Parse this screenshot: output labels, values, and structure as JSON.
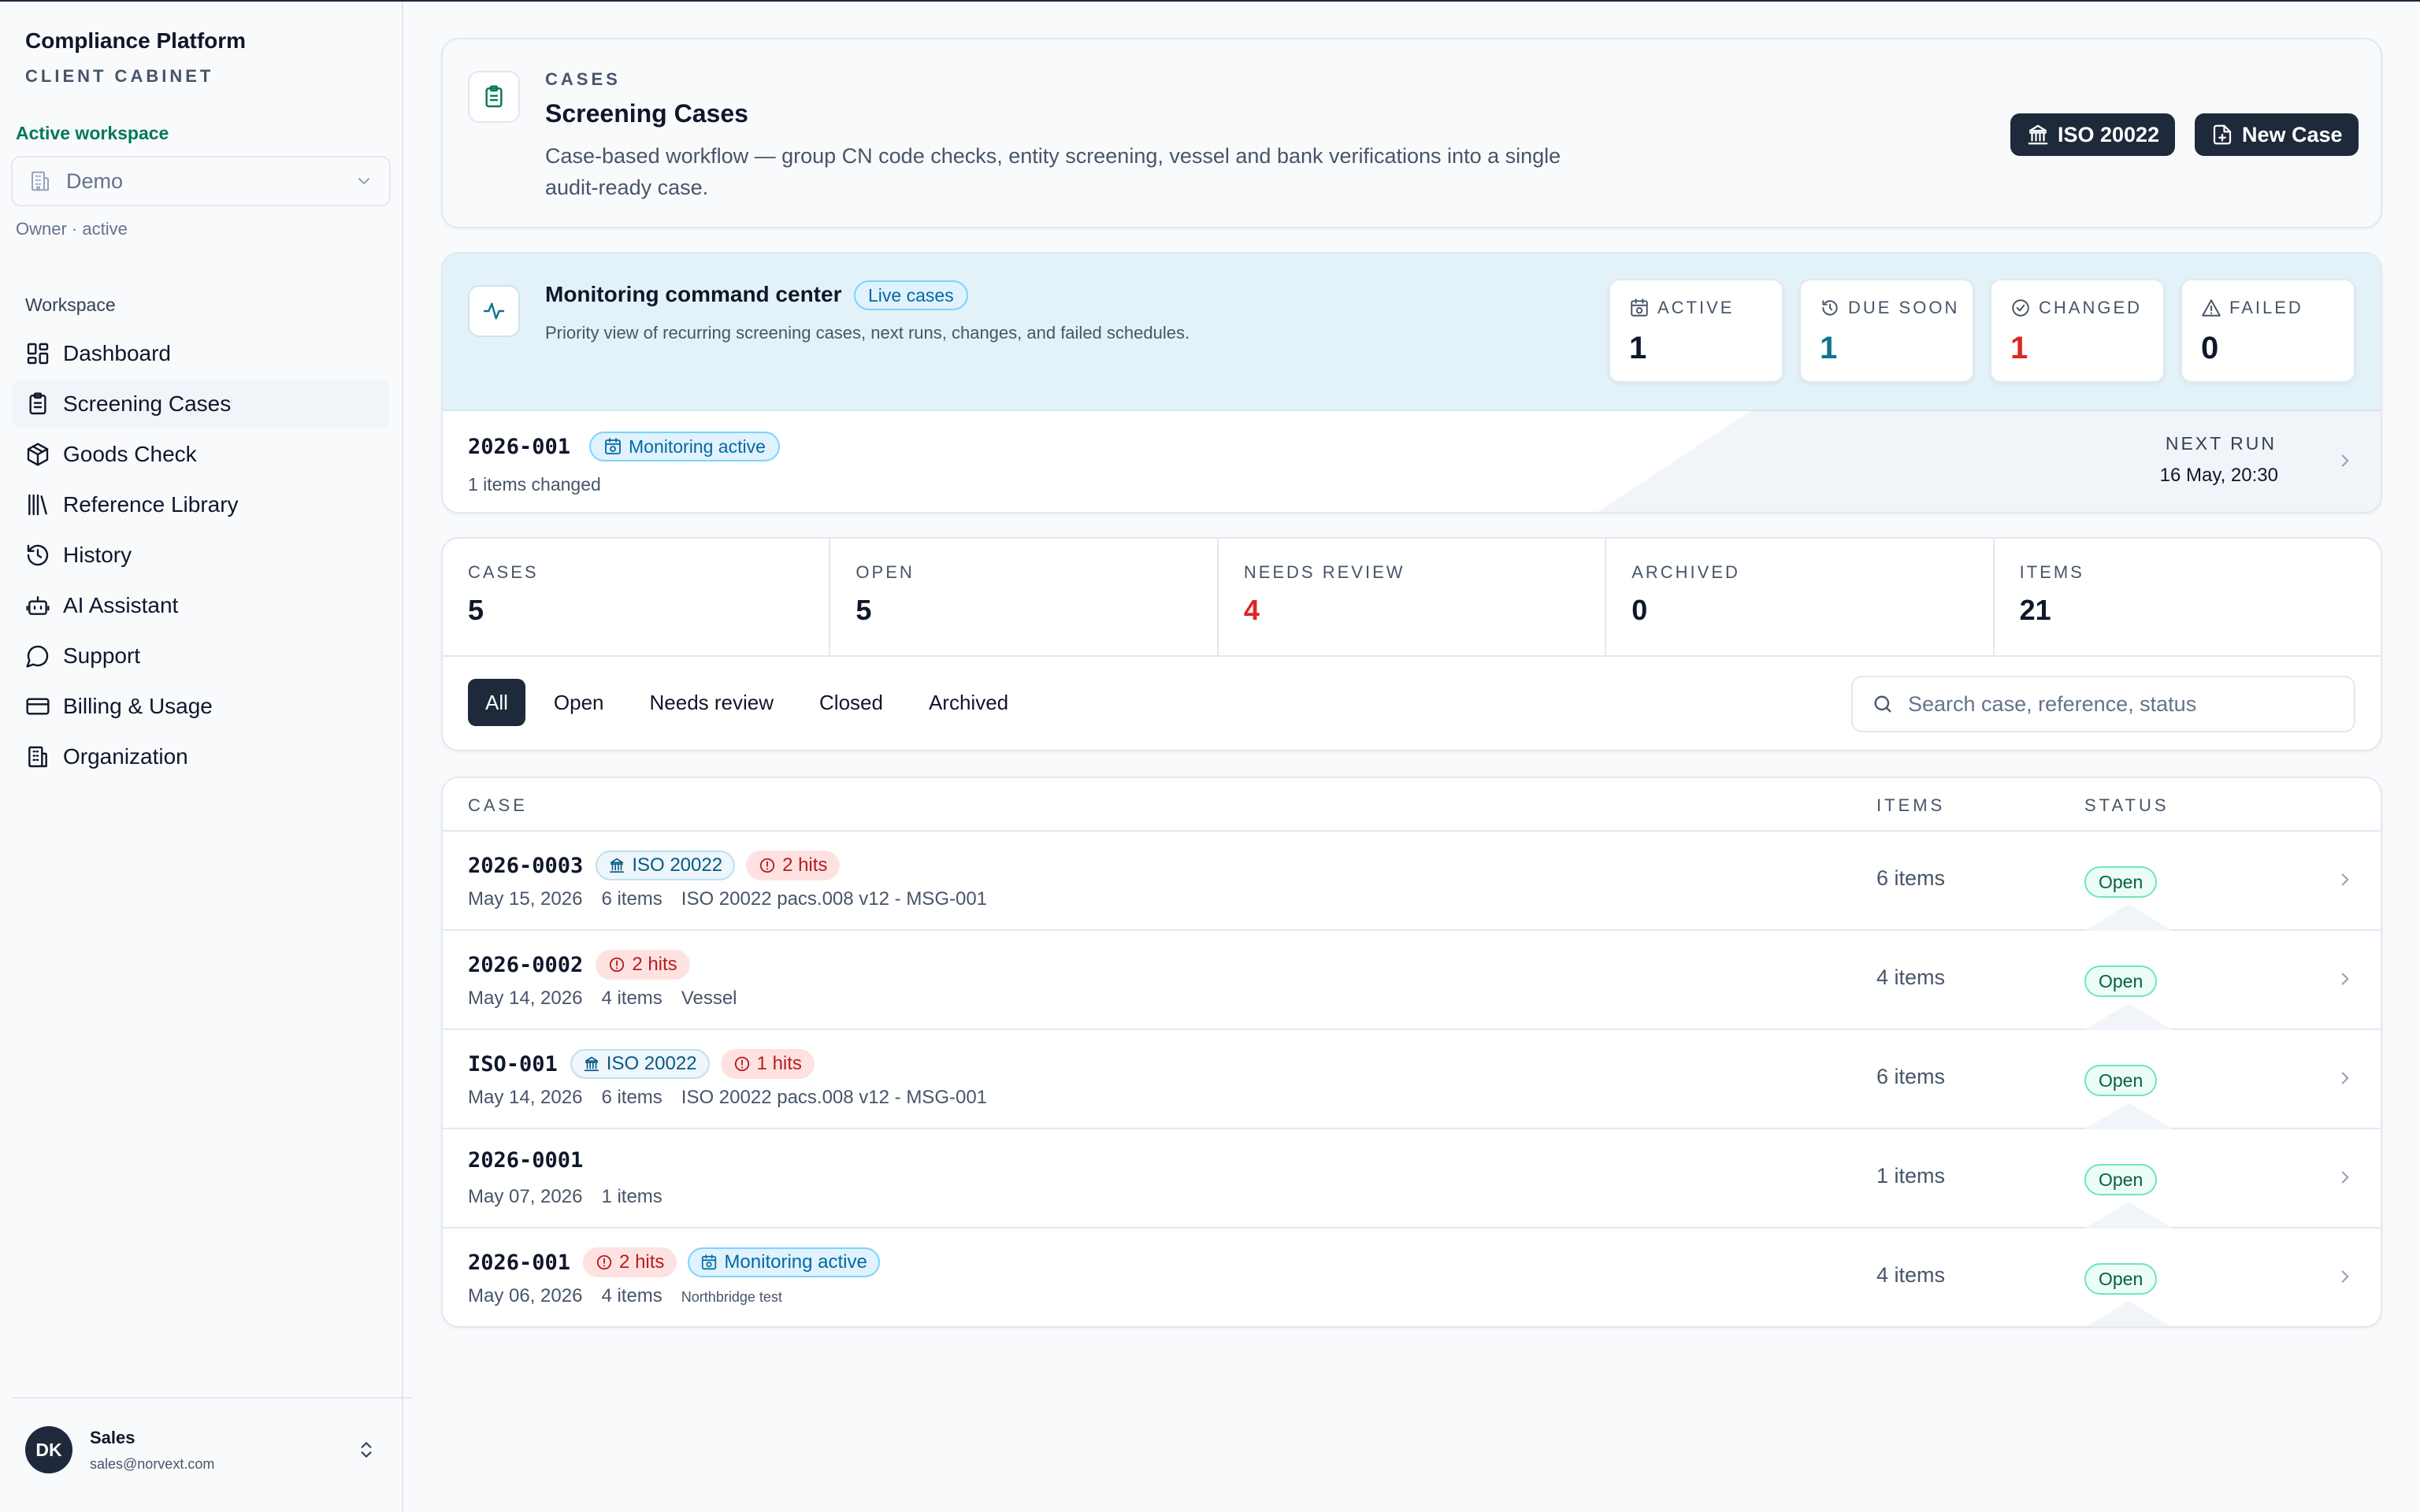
{
  "app": {
    "title": "Compliance Platform",
    "subtitle": "CLIENT CABINET"
  },
  "workspace": {
    "label": "Active workspace",
    "selected": "Demo",
    "role": "Owner · active"
  },
  "nav": {
    "heading": "Workspace",
    "items": [
      {
        "label": "Dashboard",
        "icon": "dashboard-icon",
        "active": false
      },
      {
        "label": "Screening Cases",
        "icon": "clipboard-icon",
        "active": true
      },
      {
        "label": "Goods Check",
        "icon": "package-icon",
        "active": false
      },
      {
        "label": "Reference Library",
        "icon": "library-icon",
        "active": false
      },
      {
        "label": "History",
        "icon": "history-icon",
        "active": false
      },
      {
        "label": "AI Assistant",
        "icon": "bot-icon",
        "active": false
      },
      {
        "label": "Support",
        "icon": "chat-bubble-icon",
        "active": false
      },
      {
        "label": "Billing & Usage",
        "icon": "credit-card-icon",
        "active": false
      },
      {
        "label": "Organization",
        "icon": "building-icon",
        "active": false
      }
    ]
  },
  "user": {
    "initials": "DK",
    "name": "Sales",
    "email": "sales@norvext.com"
  },
  "header": {
    "eyebrow": "CASES",
    "title": "Screening Cases",
    "description": "Case-based workflow — group CN code checks, entity screening, vessel and bank verifications into a single audit-ready case.",
    "iso_button": "ISO 20022",
    "new_case_button": "New Case"
  },
  "monitoring": {
    "title": "Monitoring command center",
    "pill": "Live cases",
    "description": "Priority view of recurring screening cases, next runs, changes, and failed schedules.",
    "stats": [
      {
        "label": "ACTIVE",
        "value": "1",
        "icon": "calendar-clock-icon",
        "color": "#0f172a"
      },
      {
        "label": "DUE SOON",
        "value": "1",
        "icon": "timer-icon",
        "color": "#0e7490"
      },
      {
        "label": "CHANGED",
        "value": "1",
        "icon": "check-circle-icon",
        "color": "#dc2626"
      },
      {
        "label": "FAILED",
        "value": "0",
        "icon": "alert-triangle-icon",
        "color": "#0f172a"
      }
    ],
    "row": {
      "case_id": "2026-001",
      "status": "Monitoring active",
      "changed": "1 items changed",
      "next_run_label": "NEXT RUN",
      "next_run_value": "16 May, 20:30"
    }
  },
  "summary": {
    "stats": [
      {
        "label": "CASES",
        "value": "5",
        "color": "#0f172a"
      },
      {
        "label": "OPEN",
        "value": "5",
        "color": "#0f172a"
      },
      {
        "label": "NEEDS REVIEW",
        "value": "4",
        "color": "#dc2626"
      },
      {
        "label": "ARCHIVED",
        "value": "0",
        "color": "#0f172a"
      },
      {
        "label": "ITEMS",
        "value": "21",
        "color": "#0f172a"
      }
    ],
    "filters": [
      "All",
      "Open",
      "Needs review",
      "Closed",
      "Archived"
    ],
    "active_filter": "All",
    "search_placeholder": "Search case, reference, status"
  },
  "table": {
    "columns": {
      "case": "CASE",
      "items": "ITEMS",
      "status": "STATUS"
    },
    "rows": [
      {
        "case_id": "2026-0003",
        "tags": [
          {
            "type": "iso",
            "label": "ISO 20022"
          },
          {
            "type": "hits",
            "label": "2 hits"
          }
        ],
        "date": "May 15, 2026",
        "items_count": "6 items",
        "reference": "ISO 20022 pacs.008 v12 - MSG-001",
        "reference_small": false,
        "items": "6 items",
        "status": "Open"
      },
      {
        "case_id": "2026-0002",
        "tags": [
          {
            "type": "hits",
            "label": "2 hits"
          }
        ],
        "date": "May 14, 2026",
        "items_count": "4 items",
        "reference": "Vessel",
        "reference_small": false,
        "items": "4 items",
        "status": "Open"
      },
      {
        "case_id": "ISO-001",
        "tags": [
          {
            "type": "iso",
            "label": "ISO 20022"
          },
          {
            "type": "hits",
            "label": "1 hits"
          }
        ],
        "date": "May 14, 2026",
        "items_count": "6 items",
        "reference": "ISO 20022 pacs.008 v12 - MSG-001",
        "reference_small": false,
        "items": "6 items",
        "status": "Open"
      },
      {
        "case_id": "2026-0001",
        "tags": [],
        "date": "May 07, 2026",
        "items_count": "1 items",
        "reference": "",
        "reference_small": false,
        "items": "1 items",
        "status": "Open"
      },
      {
        "case_id": "2026-001",
        "tags": [
          {
            "type": "hits",
            "label": "2 hits"
          },
          {
            "type": "mon",
            "label": "Monitoring active"
          }
        ],
        "date": "May 06, 2026",
        "items_count": "4 items",
        "reference": "Northbridge test",
        "reference_small": true,
        "items": "4 items",
        "status": "Open"
      }
    ]
  }
}
